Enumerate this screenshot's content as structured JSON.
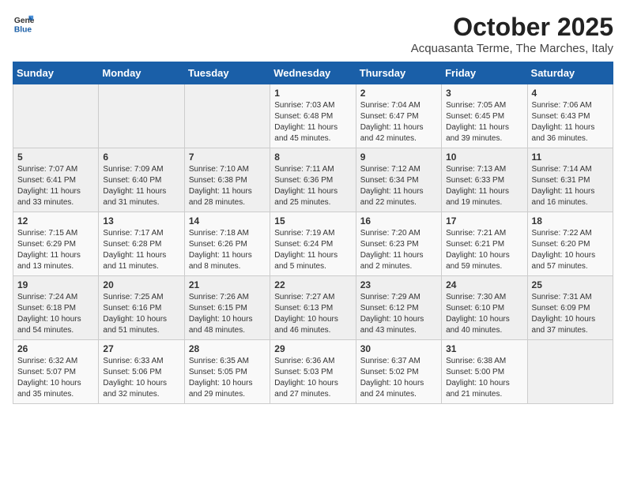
{
  "logo": {
    "general": "General",
    "blue": "Blue"
  },
  "header": {
    "month": "October 2025",
    "location": "Acquasanta Terme, The Marches, Italy"
  },
  "weekdays": [
    "Sunday",
    "Monday",
    "Tuesday",
    "Wednesday",
    "Thursday",
    "Friday",
    "Saturday"
  ],
  "weeks": [
    [
      {
        "day": "",
        "info": ""
      },
      {
        "day": "",
        "info": ""
      },
      {
        "day": "",
        "info": ""
      },
      {
        "day": "1",
        "info": "Sunrise: 7:03 AM\nSunset: 6:48 PM\nDaylight: 11 hours\nand 45 minutes."
      },
      {
        "day": "2",
        "info": "Sunrise: 7:04 AM\nSunset: 6:47 PM\nDaylight: 11 hours\nand 42 minutes."
      },
      {
        "day": "3",
        "info": "Sunrise: 7:05 AM\nSunset: 6:45 PM\nDaylight: 11 hours\nand 39 minutes."
      },
      {
        "day": "4",
        "info": "Sunrise: 7:06 AM\nSunset: 6:43 PM\nDaylight: 11 hours\nand 36 minutes."
      }
    ],
    [
      {
        "day": "5",
        "info": "Sunrise: 7:07 AM\nSunset: 6:41 PM\nDaylight: 11 hours\nand 33 minutes."
      },
      {
        "day": "6",
        "info": "Sunrise: 7:09 AM\nSunset: 6:40 PM\nDaylight: 11 hours\nand 31 minutes."
      },
      {
        "day": "7",
        "info": "Sunrise: 7:10 AM\nSunset: 6:38 PM\nDaylight: 11 hours\nand 28 minutes."
      },
      {
        "day": "8",
        "info": "Sunrise: 7:11 AM\nSunset: 6:36 PM\nDaylight: 11 hours\nand 25 minutes."
      },
      {
        "day": "9",
        "info": "Sunrise: 7:12 AM\nSunset: 6:34 PM\nDaylight: 11 hours\nand 22 minutes."
      },
      {
        "day": "10",
        "info": "Sunrise: 7:13 AM\nSunset: 6:33 PM\nDaylight: 11 hours\nand 19 minutes."
      },
      {
        "day": "11",
        "info": "Sunrise: 7:14 AM\nSunset: 6:31 PM\nDaylight: 11 hours\nand 16 minutes."
      }
    ],
    [
      {
        "day": "12",
        "info": "Sunrise: 7:15 AM\nSunset: 6:29 PM\nDaylight: 11 hours\nand 13 minutes."
      },
      {
        "day": "13",
        "info": "Sunrise: 7:17 AM\nSunset: 6:28 PM\nDaylight: 11 hours\nand 11 minutes."
      },
      {
        "day": "14",
        "info": "Sunrise: 7:18 AM\nSunset: 6:26 PM\nDaylight: 11 hours\nand 8 minutes."
      },
      {
        "day": "15",
        "info": "Sunrise: 7:19 AM\nSunset: 6:24 PM\nDaylight: 11 hours\nand 5 minutes."
      },
      {
        "day": "16",
        "info": "Sunrise: 7:20 AM\nSunset: 6:23 PM\nDaylight: 11 hours\nand 2 minutes."
      },
      {
        "day": "17",
        "info": "Sunrise: 7:21 AM\nSunset: 6:21 PM\nDaylight: 10 hours\nand 59 minutes."
      },
      {
        "day": "18",
        "info": "Sunrise: 7:22 AM\nSunset: 6:20 PM\nDaylight: 10 hours\nand 57 minutes."
      }
    ],
    [
      {
        "day": "19",
        "info": "Sunrise: 7:24 AM\nSunset: 6:18 PM\nDaylight: 10 hours\nand 54 minutes."
      },
      {
        "day": "20",
        "info": "Sunrise: 7:25 AM\nSunset: 6:16 PM\nDaylight: 10 hours\nand 51 minutes."
      },
      {
        "day": "21",
        "info": "Sunrise: 7:26 AM\nSunset: 6:15 PM\nDaylight: 10 hours\nand 48 minutes."
      },
      {
        "day": "22",
        "info": "Sunrise: 7:27 AM\nSunset: 6:13 PM\nDaylight: 10 hours\nand 46 minutes."
      },
      {
        "day": "23",
        "info": "Sunrise: 7:29 AM\nSunset: 6:12 PM\nDaylight: 10 hours\nand 43 minutes."
      },
      {
        "day": "24",
        "info": "Sunrise: 7:30 AM\nSunset: 6:10 PM\nDaylight: 10 hours\nand 40 minutes."
      },
      {
        "day": "25",
        "info": "Sunrise: 7:31 AM\nSunset: 6:09 PM\nDaylight: 10 hours\nand 37 minutes."
      }
    ],
    [
      {
        "day": "26",
        "info": "Sunrise: 6:32 AM\nSunset: 5:07 PM\nDaylight: 10 hours\nand 35 minutes."
      },
      {
        "day": "27",
        "info": "Sunrise: 6:33 AM\nSunset: 5:06 PM\nDaylight: 10 hours\nand 32 minutes."
      },
      {
        "day": "28",
        "info": "Sunrise: 6:35 AM\nSunset: 5:05 PM\nDaylight: 10 hours\nand 29 minutes."
      },
      {
        "day": "29",
        "info": "Sunrise: 6:36 AM\nSunset: 5:03 PM\nDaylight: 10 hours\nand 27 minutes."
      },
      {
        "day": "30",
        "info": "Sunrise: 6:37 AM\nSunset: 5:02 PM\nDaylight: 10 hours\nand 24 minutes."
      },
      {
        "day": "31",
        "info": "Sunrise: 6:38 AM\nSunset: 5:00 PM\nDaylight: 10 hours\nand 21 minutes."
      },
      {
        "day": "",
        "info": ""
      }
    ]
  ]
}
